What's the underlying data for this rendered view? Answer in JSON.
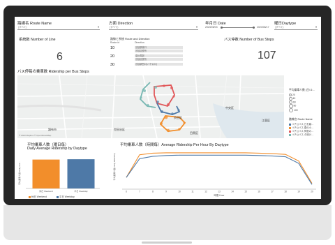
{
  "filters": {
    "route_name": {
      "label": "路線名 Route Name",
      "value": "(すべて)"
    },
    "direction": {
      "label": "方面 Direction",
      "value": "(すべて)"
    },
    "date": {
      "label": "年月日 Date",
      "from": "2023/06/03",
      "to": "2023/06/17"
    },
    "daytype": {
      "label": "曜日Daytype",
      "value": "(すべて)"
    }
  },
  "kpis": {
    "lines": {
      "label": "系統数 Number of Line",
      "value": "6"
    },
    "stops": {
      "label": "バス停数 Number of Bus Stops",
      "value": "107"
    }
  },
  "route_table": {
    "title": "路線と系統 Route and Direction",
    "col_route": "Route id",
    "col_direction": "Direction",
    "rows": [
      {
        "route": "10",
        "cells": [
          "渋谷駅東口",
          "渋谷区役所"
        ]
      },
      {
        "route": "20",
        "cells": [
          "恵比寿駅",
          "渋谷区役所"
        ]
      },
      {
        "route": "30",
        "cells": [
          "渋谷駅西口(ハチ公口)"
        ]
      }
    ]
  },
  "map": {
    "title": "バス停毎の乗車数 Ridership per Bus Stops",
    "places": [
      "渋谷区",
      "世田谷区",
      "目黒区",
      "中央区",
      "江東区",
      "調布市"
    ],
    "attribution": "© 2023 Mapbox © OpenStreetMap",
    "size_legend": {
      "title": "平均乗車人数 (日/ル…",
      "items": [
        "20",
        "40",
        "60",
        "80",
        "100"
      ]
    },
    "route_legend": {
      "title": "路線名 Route Name",
      "items": [
        {
          "label": "ハチ公バス 丘を越…",
          "color": "#4e79a7"
        },
        {
          "label": "ハチ公バス 春の小…",
          "color": "#f28e2b"
        },
        {
          "label": "ハチ公バス 神宮の…",
          "color": "#e15759"
        },
        {
          "label": "ハチ公バス 夕焼け…",
          "color": "#76b7b2"
        }
      ]
    }
  },
  "daily_chart": {
    "title_jp": "平均乗車人数（曜日毎）",
    "title_en": "Daily Average Ridership by Daytype",
    "ylabel": "平均乗車人数 Daily Ave...",
    "legend": [
      {
        "label": "休日 Weekend",
        "color": "#f28e2b"
      },
      {
        "label": "平日 Weekday",
        "color": "#4e79a7"
      }
    ]
  },
  "hourly_chart": {
    "title": "平均乗車人数（時間毎）Average Ridership Per Hour By Daytype",
    "ylabel": "平均乗車人数 Daily Ridership",
    "xlabel": "時間 Hour"
  },
  "chart_data": [
    {
      "type": "bar",
      "categories": [
        "休日 Weekend",
        "平日 Weekday"
      ],
      "values": [
        90,
        91
      ],
      "ylim": [
        0,
        100
      ]
    },
    {
      "type": "line",
      "x": [
        6,
        7,
        8,
        9,
        10,
        11,
        12,
        13,
        14,
        15,
        16,
        17,
        18,
        19,
        20
      ],
      "series": [
        {
          "name": "休日 Weekend",
          "color": "#f28e2b",
          "values": [
            30,
            88,
            92,
            93,
            93,
            93,
            93,
            93,
            93,
            93,
            92,
            91,
            89,
            72,
            15
          ]
        },
        {
          "name": "平日 Weekday",
          "color": "#4e79a7",
          "values": [
            30,
            78,
            84,
            86,
            87,
            87,
            87,
            87,
            87,
            87,
            86,
            85,
            83,
            66,
            12
          ]
        }
      ],
      "xticks": [
        "6",
        "7",
        "8",
        "9",
        "10",
        "11",
        "12",
        "13",
        "14",
        "15",
        "16",
        "17",
        "18",
        "19",
        "20"
      ],
      "ylim": [
        0,
        100
      ]
    }
  ]
}
